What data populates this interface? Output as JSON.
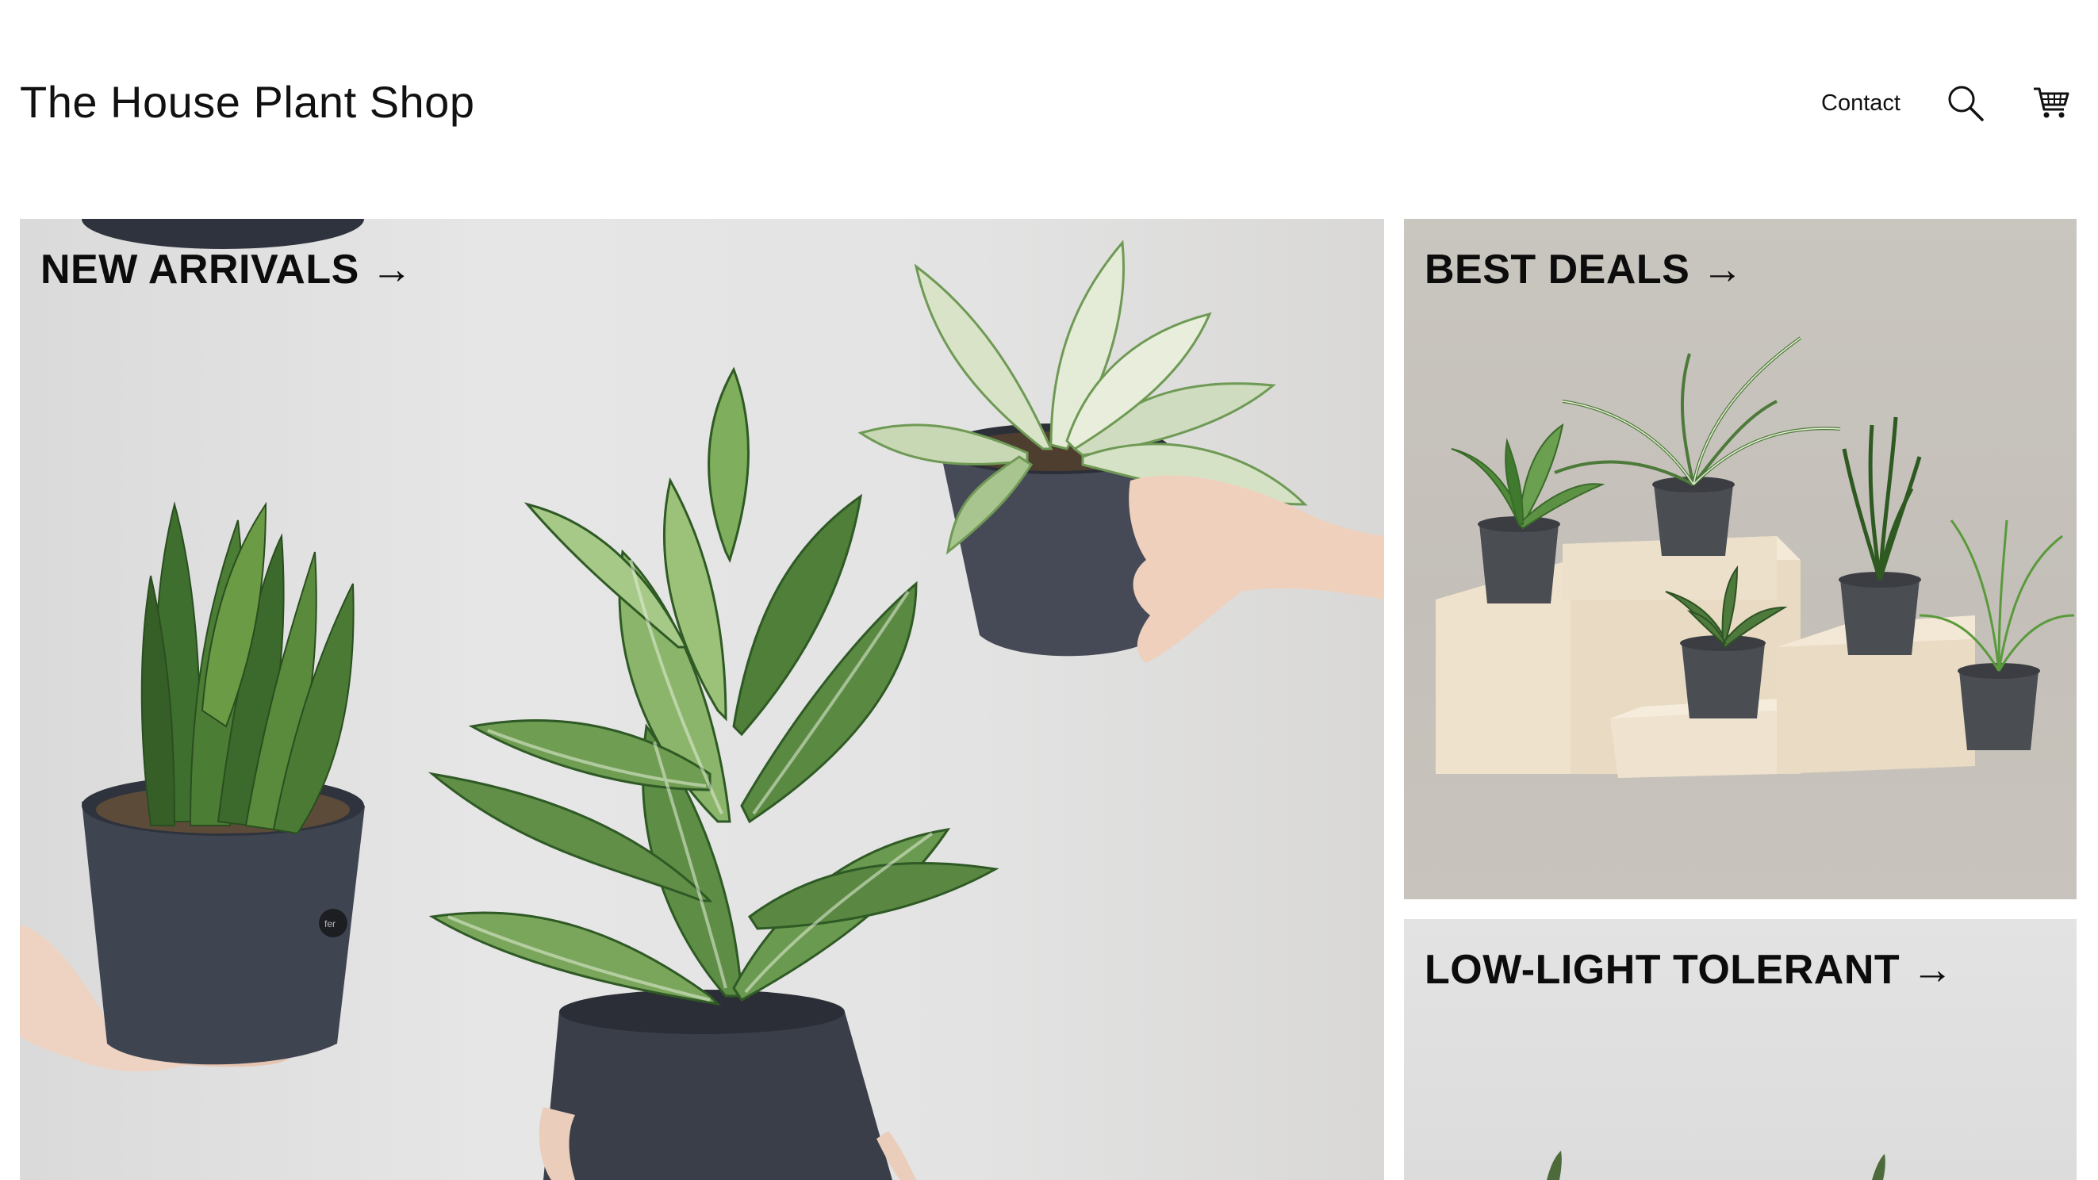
{
  "header": {
    "title": "The House Plant Shop",
    "nav": {
      "contact_label": "Contact",
      "search_icon": "search-icon",
      "cart_icon": "cart-icon"
    }
  },
  "tiles": [
    {
      "label": "NEW ARRIVALS →"
    },
    {
      "label": "BEST DEALS →"
    },
    {
      "label": "LOW-LIGHT TOLERANT →"
    }
  ],
  "pot_brand": "fer"
}
